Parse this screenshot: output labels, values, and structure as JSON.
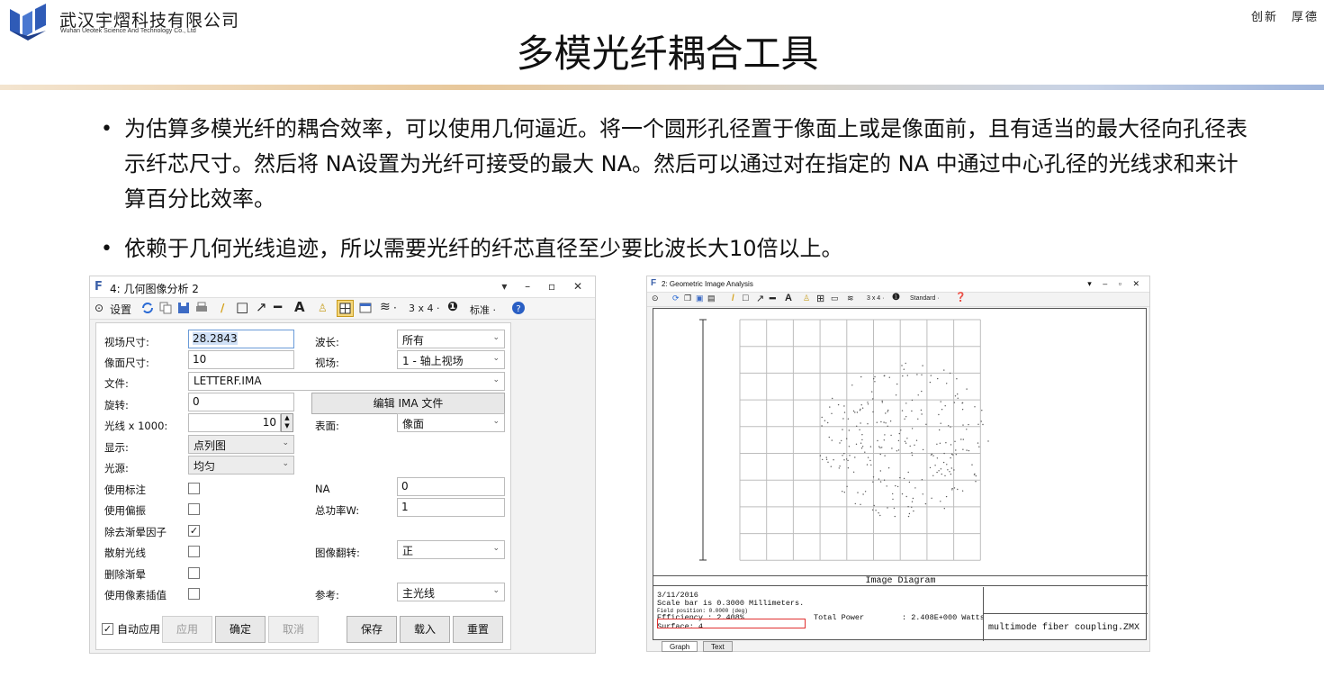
{
  "slide": {
    "company_cn": "武汉宇熠科技有限公司",
    "company_en": "Wuhan Ueotek Science And Technology Co., Ltd",
    "motto": "创新　厚德",
    "title": "多模光纤耦合工具",
    "bullets": [
      "为估算多模光纤的耦合效率，可以使用几何逼近。将一个圆形孔径置于像面上或是像面前，且有适当的最大径向孔径表示纤芯尺寸。然后将 NA设置为光纤可接受的最大 NA。然后可以通过对在指定的 NA 中通过中心孔径的光线求和来计算百分比效率。",
      "依赖于几何光线追迹，所以需要光纤的纤芯直径至少要比波长大10倍以上。"
    ],
    "colors": {
      "logo_blue": "#2f5bb7",
      "bar_warm": "#e8c89b",
      "bar_cool": "#9fb5dc"
    }
  },
  "left_window": {
    "title": "4: 几何图像分析 2",
    "controls": "▾ – ▫ ✕",
    "toolbar": {
      "settings": "设置",
      "grid": "3 x 4 ·",
      "standard": "标准 ·"
    },
    "fields": {
      "field_size_label": "视场尺寸:",
      "field_size_value": "28.2843",
      "image_size_label": "像面尺寸:",
      "image_size_value": "10",
      "file_label": "文件:",
      "file_value": "LETTERF.IMA",
      "rotation_label": "旋转:",
      "rotation_value": "0",
      "rays_label": "光线 x 1000:",
      "rays_value": "10",
      "display_label": "显示:",
      "display_value": "点列图",
      "source_label": "光源:",
      "source_value": "均匀",
      "use_marker_label": "使用标注",
      "use_polarization_label": "使用偏振",
      "remove_vignetting_label": "除去渐晕因子",
      "scatter_rays_label": "散射光线",
      "delete_vignetting_label": "删除渐晕",
      "pixel_interp_label": "使用像素插值",
      "wavelength_label": "波长:",
      "wavelength_value": "所有",
      "field_label": "视场:",
      "field_value": "1 - 轴上视场",
      "edit_ima_button": "编辑 IMA 文件",
      "surface_label": "表面:",
      "surface_value": "像面",
      "na_label": "NA",
      "na_value": "0",
      "total_power_label": "总功率W:",
      "total_power_value": "1",
      "image_flip_label": "图像翻转:",
      "image_flip_value": "正",
      "reference_label": "参考:",
      "reference_value": "主光线"
    },
    "checkbox_states": {
      "use_marker": false,
      "use_polarization": false,
      "remove_vignetting": true,
      "scatter_rays": false,
      "delete_vignetting": false,
      "pixel_interp": false,
      "auto_apply": true
    },
    "check_mark": "✓",
    "buttons": {
      "auto_apply": "自动应用",
      "apply": "应用",
      "ok": "确定",
      "cancel": "取消",
      "save": "保存",
      "load": "载入",
      "reset": "重置"
    }
  },
  "right_window": {
    "title": "2: Geometric Image Analysis",
    "controls": "▾ – ▫ ✕",
    "toolbar": {
      "grid": "3 x 4 ·",
      "standard": "Standard ·"
    },
    "diagram_title": "Image Diagram",
    "date": "3/11/2016",
    "scale_bar": "Scale bar is 0.3000 Millimeters.",
    "field_position": "Field position:    0.0000 (deg)",
    "efficiency": "Efficiency      :   2.408%",
    "total_power": "Total Power",
    "total_power_value": ": 2.408E+000 Watts",
    "surface": "Surface: 4",
    "filename": "multimode fiber coupling.ZMX",
    "tabs": [
      "Graph",
      "Text"
    ]
  }
}
